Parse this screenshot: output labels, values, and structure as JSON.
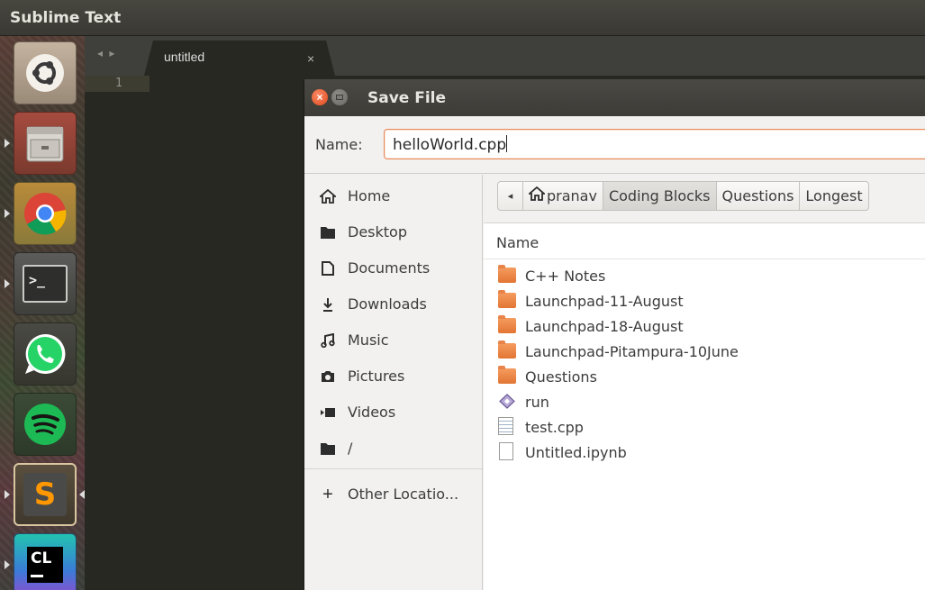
{
  "panel": {
    "app_title": "Sublime Text"
  },
  "launcher": {
    "items": [
      {
        "name": "ubuntu-dash-icon"
      },
      {
        "name": "file-manager-icon"
      },
      {
        "name": "chrome-icon"
      },
      {
        "name": "terminal-icon",
        "glyph": ">_"
      },
      {
        "name": "whatsapp-icon"
      },
      {
        "name": "spotify-icon"
      },
      {
        "name": "sublime-text-icon",
        "glyph": "S"
      },
      {
        "name": "clion-icon",
        "glyph": "CL"
      }
    ]
  },
  "editor": {
    "tab_nav": "◂ ▸",
    "tab": {
      "label": "untitled",
      "close": "×"
    },
    "line_number": "1"
  },
  "dialog": {
    "title": "Save File",
    "close_glyph": "×",
    "name_label": "Name:",
    "name_value": "helloWorld.cpp",
    "places": [
      {
        "icon": "home-icon",
        "glyph": "⌂",
        "label": "Home"
      },
      {
        "icon": "desktop-icon",
        "glyph": "▆",
        "label": "Desktop"
      },
      {
        "icon": "documents-icon",
        "glyph": "🗋",
        "label": "Documents"
      },
      {
        "icon": "downloads-icon",
        "glyph": "⤓",
        "label": "Downloads"
      },
      {
        "icon": "music-icon",
        "glyph": "♫",
        "label": "Music"
      },
      {
        "icon": "pictures-icon",
        "glyph": "◙",
        "label": "Pictures"
      },
      {
        "icon": "videos-icon",
        "glyph": "▶",
        "label": "Videos"
      },
      {
        "icon": "filesystem-icon",
        "glyph": "▆",
        "label": "/"
      },
      {
        "icon": "plus-icon",
        "glyph": "+",
        "label": "Other Locatio..."
      }
    ],
    "path_back": "◂",
    "path": [
      {
        "label": "pranav",
        "home": true
      },
      {
        "label": "Coding Blocks",
        "active": true
      },
      {
        "label": "Questions"
      },
      {
        "label": "Longest"
      }
    ],
    "column_header": "Name",
    "files": [
      {
        "name": "C++ Notes",
        "type": "folder"
      },
      {
        "name": "Launchpad-11-August",
        "type": "folder"
      },
      {
        "name": "Launchpad-18-August",
        "type": "folder"
      },
      {
        "name": "Launchpad-Pitampura-10June",
        "type": "folder"
      },
      {
        "name": "Questions",
        "type": "folder"
      },
      {
        "name": "run",
        "type": "executable"
      },
      {
        "name": "test.cpp",
        "type": "source"
      },
      {
        "name": "Untitled.ipynb",
        "type": "document"
      }
    ]
  }
}
